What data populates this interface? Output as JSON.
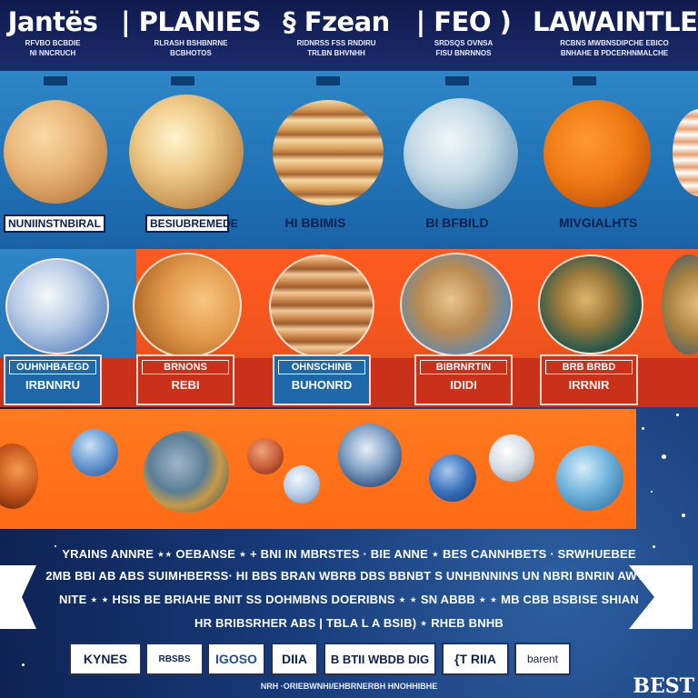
{
  "header": {
    "cols": [
      {
        "title": "Jantës",
        "sub1": "RFVBO BCBDIE",
        "sub2": "NI NNCRUCH"
      },
      {
        "title": "| PLANIES",
        "sub1": "RLRASH BSHBNRNE",
        "sub2": "BCBHOTOS"
      },
      {
        "title": "§ Fzean",
        "sub1": "RIDNRSS FSS RNDIRU",
        "sub2": "TRLBN BHVNHH"
      },
      {
        "title": "| FEO )",
        "sub1": "SRDSQS OVNSA",
        "sub2": "FISU BNRNNOS"
      },
      {
        "title": "LAWAINTLE",
        "sub1": "RCBNS MWBNSDIPCHE EBICO",
        "sub2": "BNHAHE B PDCERHNMALCHE"
      }
    ]
  },
  "band1": {
    "tags": [
      {
        "l1": "",
        "l2": "NUNIINSTNBIRAL"
      },
      {
        "l1": "",
        "l2": "BESIUBREMEDE"
      },
      {
        "l1": "",
        "l2": "HI BBIMIS"
      },
      {
        "l1": "",
        "l2": "BI BFBILD"
      },
      {
        "l1": "",
        "l2": "MIVGIALHTS"
      }
    ]
  },
  "band2": {
    "tags": [
      {
        "l1": "OUHNHBAEGD",
        "l2": "IRBNNRU"
      },
      {
        "l1": "BRNONS",
        "l2": "REBI"
      },
      {
        "l1": "OHNSCHINB",
        "l2": "BUHONRD"
      },
      {
        "l1": "BIBRNRTIN",
        "l2": "IDIDI"
      },
      {
        "l1": "BRB BRBD",
        "l2": "IRRNIR"
      }
    ]
  },
  "footer": {
    "line1": "YRAINS ANNRE ⋆⋆ OEBANSE ⋆ + BNI IN MBRSTES · BIE ANNE ⋆ BES CANNHBETS · SRWHUEBEE",
    "line2": "2MB BBI AB ABS SUIMHBERSS· HI BBS BRAN WBRB DBS BBNBT S UNHBNNINS UN NBRI BNRIN AWTE",
    "line3": "NITE ⋆ ⋆ HSIS BE BRIAHE BNIT SS DOHMBNS DOERIBNS ⋆ ⋆ SN ABBB ⋆ ⋆ MB CBB BSBISE SHIAN",
    "line4": "HR BRIBSRHER ABS | TBLA L A BSIB) ⋆ RHEB BNHB",
    "logos": [
      "KYNES",
      "RBSBS",
      "IGOSO",
      "DIIA",
      "B BTII WBDB DIG",
      "{T RIIA",
      "barent"
    ],
    "bottom": "NRH ·ORIEBWNHI/EHBRNERBH HNOHHIBHE",
    "best": "BEST"
  }
}
